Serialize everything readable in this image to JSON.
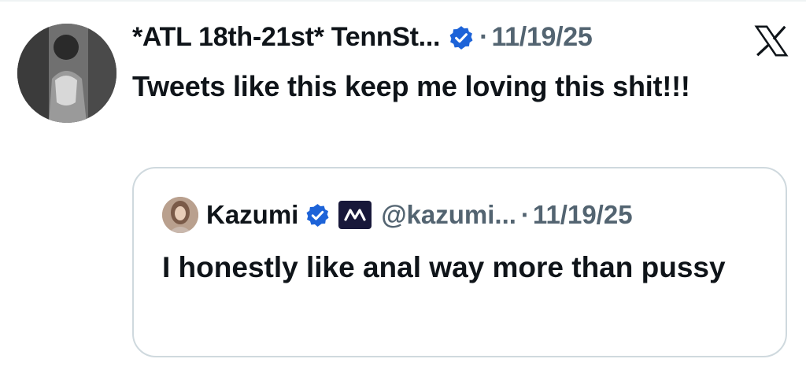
{
  "tweet": {
    "author_name": "*ATL 18th-21st* TennSt...",
    "separator": "·",
    "date": "11/19/25",
    "text": "Tweets like this keep me loving this shit!!!"
  },
  "quoted_tweet": {
    "author_name": "Kazumi",
    "handle": "@kazumi...",
    "separator": "·",
    "date": "11/19/25",
    "text": "I honestly like anal way more than pussy"
  },
  "icons": {
    "verified": "verified-badge-icon",
    "affiliate": "affiliate-badge-icon",
    "platform": "x-logo-icon"
  },
  "colors": {
    "verified_blue": "#1d63d8",
    "secondary_text": "#536471",
    "border": "#cfd9de"
  }
}
